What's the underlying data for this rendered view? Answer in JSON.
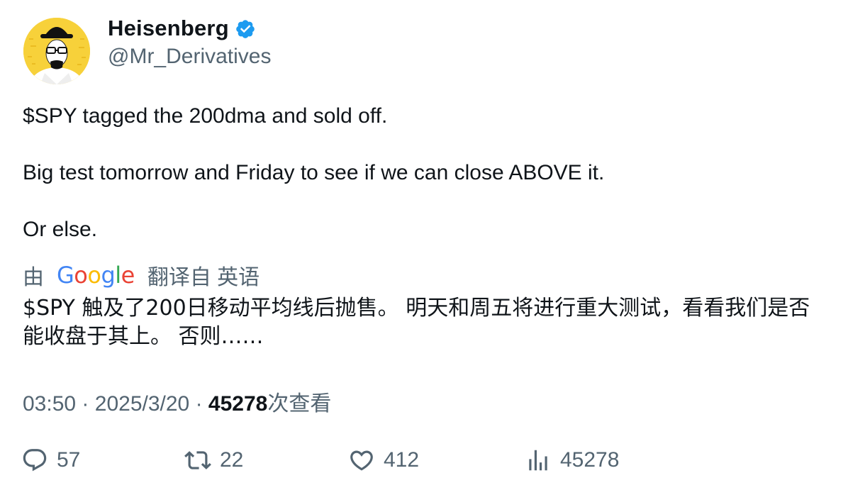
{
  "author": {
    "display_name": "Heisenberg",
    "handle": "@Mr_Derivatives",
    "verified_icon": "verified-badge-icon",
    "verified_color": "#1d9bf0",
    "avatar_bg": "#f7d13a"
  },
  "tweet": {
    "lines": [
      "$SPY tagged the 200dma and sold off.",
      "Big test tomorrow and Friday to see if we can close ABOVE it.",
      "Or else."
    ]
  },
  "translation": {
    "by_label": "由",
    "provider": "Google",
    "translated_from": "翻译自 英语",
    "text": "$SPY 触及了200日移动平均线后抛售。 明天和周五将进行重大测试，看看我们是否能收盘于其上。 否则……"
  },
  "meta": {
    "time": "03:50",
    "date": "2025/3/20",
    "separator": "·",
    "views_count": "45278",
    "views_label": "次查看"
  },
  "actions": {
    "reply": {
      "icon": "reply-icon",
      "count": "57"
    },
    "retweet": {
      "icon": "retweet-icon",
      "count": "22"
    },
    "like": {
      "icon": "heart-icon",
      "count": "412"
    },
    "views": {
      "icon": "bar-chart-icon",
      "count": "45278"
    }
  },
  "colors": {
    "text_primary": "#0f1419",
    "text_secondary": "#536471"
  }
}
